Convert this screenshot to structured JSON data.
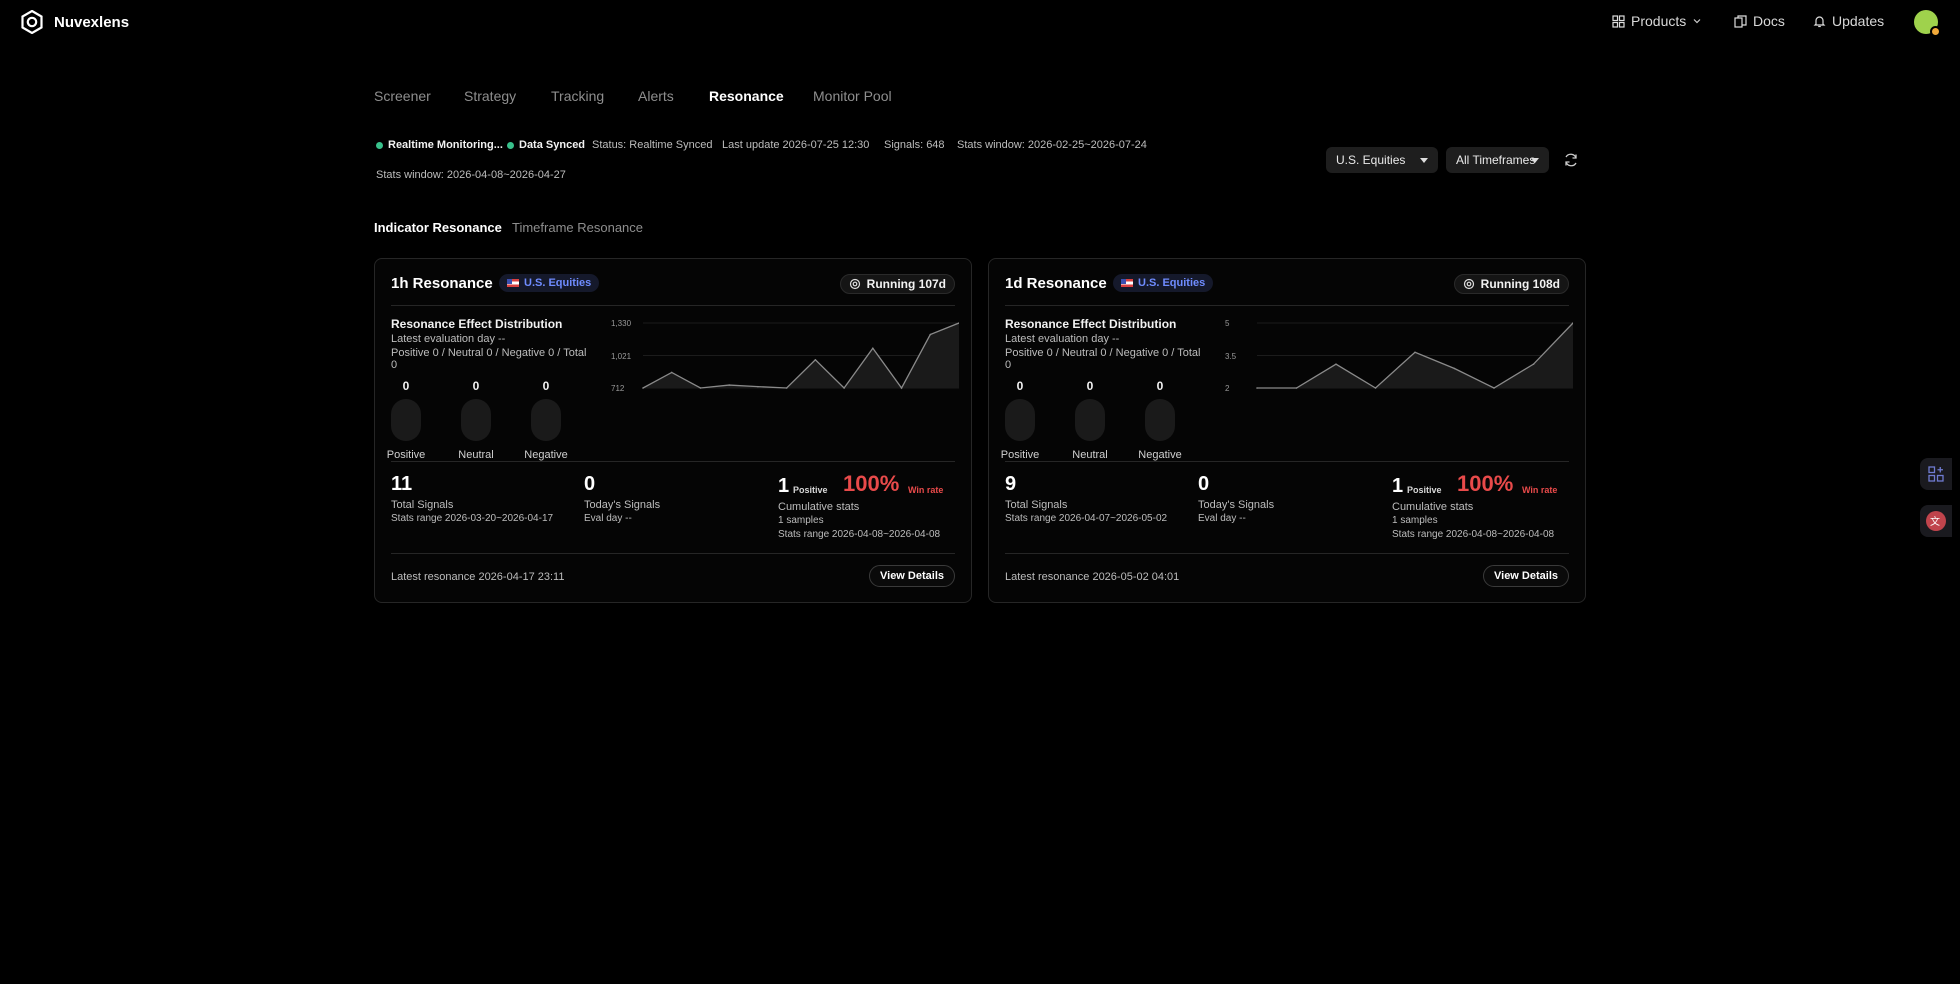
{
  "app": {
    "name": "Nuvexlens"
  },
  "topnav": {
    "products": "Products",
    "docs": "Docs",
    "updates": "Updates"
  },
  "tabs": [
    "Screener",
    "Strategy",
    "Tracking",
    "Alerts",
    "Resonance",
    "Monitor Pool"
  ],
  "active_tab": "Resonance",
  "status": {
    "monitoring": "Realtime Monitoring...",
    "synced": "Data Synced",
    "status_text": "Status: Realtime Synced",
    "last_update": "Last update 2026-07-25 12:30",
    "signals": "Signals: 648",
    "stats_window": "Stats window: 2026-02-25~2026-07-24",
    "stats_window_2": "Stats window: 2026-04-08~2026-04-27"
  },
  "filters": {
    "market": "U.S. Equities",
    "timeframe": "All Timeframes"
  },
  "subtabs": [
    "Indicator Resonance",
    "Timeframe Resonance"
  ],
  "cards": [
    {
      "title": "1h Resonance",
      "market_badge": "U.S. Equities",
      "running": "Running 107d",
      "dist_title": "Resonance Effect Distribution",
      "eval_day": "Latest evaluation day --",
      "counts": "Positive 0 / Neutral 0 / Negative 0 / Total 0",
      "pills": [
        {
          "value": "0",
          "label": "Positive"
        },
        {
          "value": "0",
          "label": "Neutral"
        },
        {
          "value": "0",
          "label": "Negative"
        }
      ],
      "total_signals": "11",
      "total_signals_label": "Total Signals",
      "total_range": "Stats range 2026-03-20~2026-04-17",
      "today_signals": "0",
      "today_label": "Today's Signals",
      "eval_day_short": "Eval day --",
      "cum_count": "1",
      "cum_positive": "Positive",
      "win_rate": "100%",
      "win_rate_label": "Win rate",
      "cum_label": "Cumulative stats",
      "samples": "1 samples",
      "cum_range": "Stats range 2026-04-08~2026-04-08",
      "latest": "Latest resonance 2026-04-17 23:11",
      "details": "View Details"
    },
    {
      "title": "1d Resonance",
      "market_badge": "U.S. Equities",
      "running": "Running 108d",
      "dist_title": "Resonance Effect Distribution",
      "eval_day": "Latest evaluation day --",
      "counts": "Positive 0 / Neutral 0 / Negative 0 / Total 0",
      "pills": [
        {
          "value": "0",
          "label": "Positive"
        },
        {
          "value": "0",
          "label": "Neutral"
        },
        {
          "value": "0",
          "label": "Negative"
        }
      ],
      "total_signals": "9",
      "total_signals_label": "Total Signals",
      "total_range": "Stats range 2026-04-07~2026-05-02",
      "today_signals": "0",
      "today_label": "Today's Signals",
      "eval_day_short": "Eval day --",
      "cum_count": "1",
      "cum_positive": "Positive",
      "win_rate": "100%",
      "win_rate_label": "Win rate",
      "cum_label": "Cumulative stats",
      "samples": "1 samples",
      "cum_range": "Stats range 2026-04-08~2026-04-08",
      "latest": "Latest resonance 2026-05-02 04:01",
      "details": "View Details"
    }
  ],
  "chart_data": [
    {
      "type": "area",
      "title": "",
      "yticks": [
        "1,330",
        "1,021",
        "712"
      ],
      "ylim": [
        712,
        1330
      ],
      "series": [
        {
          "values": [
            712,
            860,
            712,
            740,
            725,
            712,
            980,
            712,
            1090,
            712,
            1220,
            1330
          ]
        }
      ]
    },
    {
      "type": "area",
      "title": "",
      "yticks": [
        "5",
        "3.5",
        "2"
      ],
      "ylim": [
        2,
        5
      ],
      "series": [
        {
          "values": [
            2,
            2,
            3.1,
            2,
            3.65,
            2.9,
            2,
            3.1,
            5
          ]
        }
      ]
    }
  ]
}
